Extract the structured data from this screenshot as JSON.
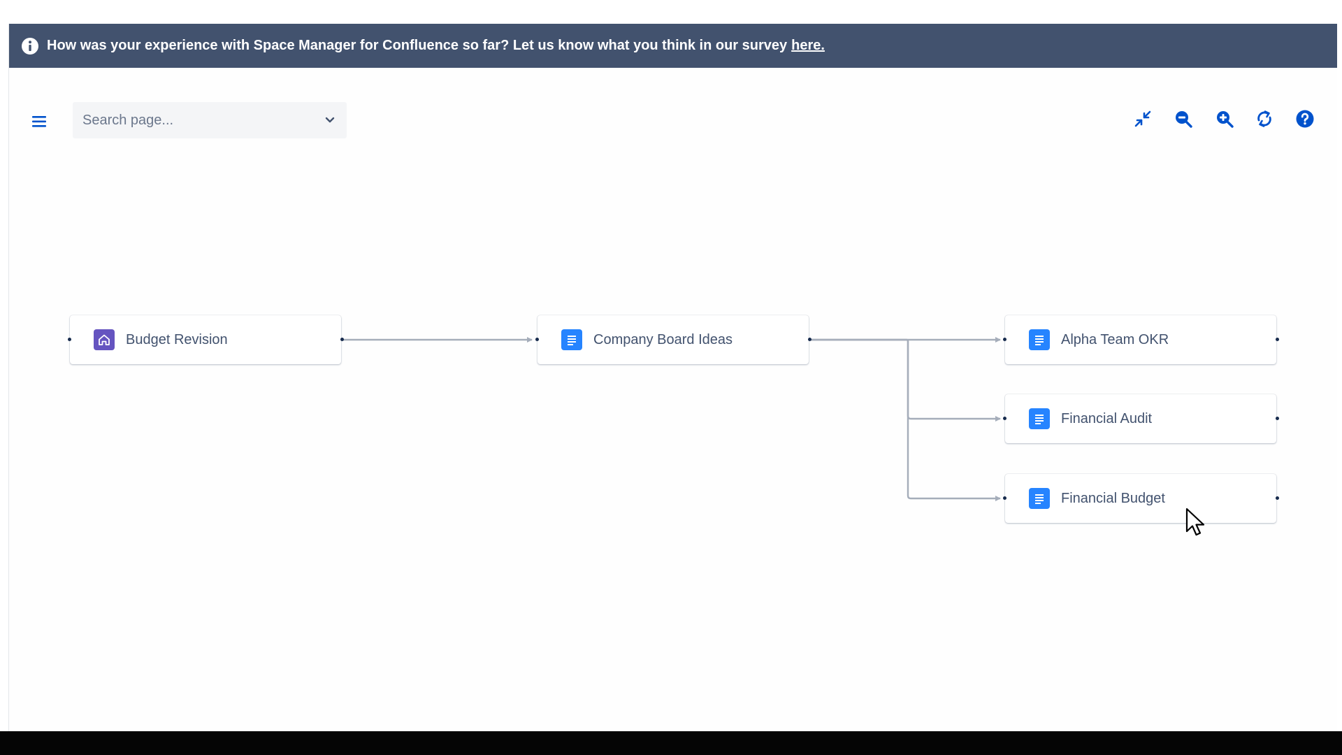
{
  "banner": {
    "message": "How was your experience with Space Manager for Confluence so far? Let us know what you think in our survey",
    "link_text": "here.",
    "background_color": "#42526e",
    "icon": "info-icon"
  },
  "toolbar": {
    "menu_icon": "hamburger-menu-icon",
    "search": {
      "placeholder": "Search page...",
      "value": ""
    },
    "buttons": [
      {
        "name": "collapse-button",
        "icon": "collapse-arrows-icon"
      },
      {
        "name": "zoom-out-button",
        "icon": "zoom-out-icon"
      },
      {
        "name": "zoom-in-button",
        "icon": "zoom-in-icon"
      },
      {
        "name": "refresh-button",
        "icon": "refresh-icon"
      },
      {
        "name": "help-button",
        "icon": "help-icon"
      }
    ],
    "accent_color": "#0052cc"
  },
  "tree": {
    "root": {
      "label": "Budget Revision",
      "icon": "home-icon",
      "icon_color": "#6554c0"
    },
    "child": {
      "label": "Company Board Ideas",
      "icon": "page-icon",
      "icon_color": "#2684ff"
    },
    "grandchildren": [
      {
        "label": "Alpha Team OKR",
        "icon": "page-icon",
        "icon_color": "#2684ff"
      },
      {
        "label": "Financial Audit",
        "icon": "page-icon",
        "icon_color": "#2684ff"
      },
      {
        "label": "Financial Budget",
        "icon": "page-icon",
        "icon_color": "#2684ff"
      }
    ],
    "connector_color": "#a5adba"
  }
}
